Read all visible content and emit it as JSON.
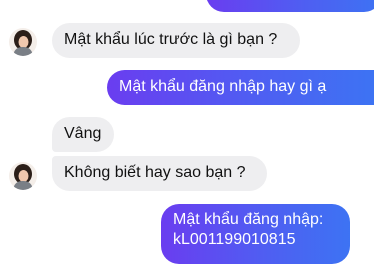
{
  "conversation": {
    "messages": [
      {
        "sender": "other",
        "text": "Mật khẩu lúc trước là gì bạn ?"
      },
      {
        "sender": "me",
        "text": "Mật khẩu đăng nhập hay gì ạ"
      },
      {
        "sender": "other",
        "text": "Vâng"
      },
      {
        "sender": "other",
        "text": "Không biết hay sao bạn ?"
      },
      {
        "sender": "me",
        "lines": [
          "Mật khẩu đăng nhập:",
          "kL001199010815"
        ]
      }
    ]
  },
  "colors": {
    "incoming_bubble": "#eeeef0",
    "outgoing_gradient_start": "#6a3df0",
    "outgoing_gradient_end": "#3d73f3",
    "incoming_text": "#111111",
    "outgoing_text": "#ffffff"
  },
  "icons": {
    "avatar": "contact-avatar-icon"
  }
}
